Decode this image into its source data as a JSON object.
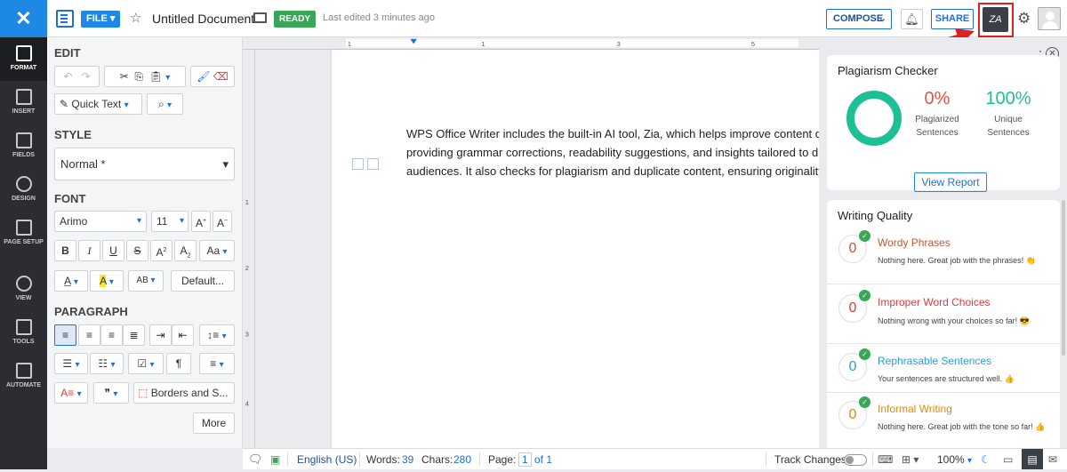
{
  "header": {
    "close_glyph": "✕",
    "file_label": "FILE ▾",
    "doc_title": "Untitled Document",
    "status": "READY",
    "last_edited": "Last edited 3 minutes ago",
    "compose_label": "COMPOSE",
    "share_label": "SHARE",
    "zia_label": "ZA"
  },
  "leftnav": [
    {
      "label": "FORMAT",
      "icon": "pen-icon"
    },
    {
      "label": "INSERT",
      "icon": "insert-icon"
    },
    {
      "label": "FIELDS",
      "icon": "fields-icon"
    },
    {
      "label": "DESIGN",
      "icon": "palette-icon"
    },
    {
      "label": "PAGE SETUP",
      "icon": "page-icon"
    },
    {
      "label": "VIEW",
      "icon": "eye-icon"
    },
    {
      "label": "TOOLS",
      "icon": "tools-icon"
    },
    {
      "label": "AUTOMATE",
      "icon": "automate-icon"
    }
  ],
  "format_panel": {
    "edit_title": "EDIT",
    "quick_text": "Quick Text",
    "style_title": "STYLE",
    "style_value": "Normal *",
    "font_title": "FONT",
    "font_name": "Arimo",
    "font_size": "11",
    "default_label": "Default...",
    "paragraph_title": "PARAGRAPH",
    "borders_label": "Borders and S...",
    "more_label": "More"
  },
  "document": {
    "lines": [
      "WPS Office Writer includes the built-in AI tool, Zia, which helps improve content q",
      "providing grammar corrections, readability suggestions, and insights tailored to di",
      "audiences. It also checks for plagiarism and duplicate content, ensuring originality"
    ]
  },
  "zia_panel": {
    "plagiarism": {
      "title": "Plagiarism Checker",
      "plagiarized_pct": "0%",
      "plagiarized_label_1": "Plagiarized",
      "plagiarized_label_2": "Sentences",
      "unique_pct": "100%",
      "unique_label_1": "Unique",
      "unique_label_2": "Sentences",
      "view_report": "View Report"
    },
    "writing_quality": {
      "title": "Writing Quality",
      "items": [
        {
          "count": "0",
          "name": "Wordy Phrases",
          "desc": "Nothing here. Great job with the phrases! 👏",
          "color": "#c8552c"
        },
        {
          "count": "0",
          "name": "Improper Word Choices",
          "desc": "Nothing wrong with your choices so far! 😎",
          "color": "#e03b3b"
        },
        {
          "count": "0",
          "name": "Rephrasable Sentences",
          "desc": "Your sentences are structured well. 👍",
          "color": "#2a9fd6"
        },
        {
          "count": "0",
          "name": "Informal Writing",
          "desc": "Nothing here. Great job with the tone so far! 👍",
          "color": "#d98a17"
        }
      ]
    }
  },
  "statusbar": {
    "language": "English (US)",
    "words_label": "Words:",
    "words_value": "39",
    "chars_label": "Chars:",
    "chars_value": "280",
    "page_label": "Page:",
    "page_current": "1",
    "page_total": "of 1",
    "track_changes": "Track Changes",
    "zoom": "100%"
  }
}
